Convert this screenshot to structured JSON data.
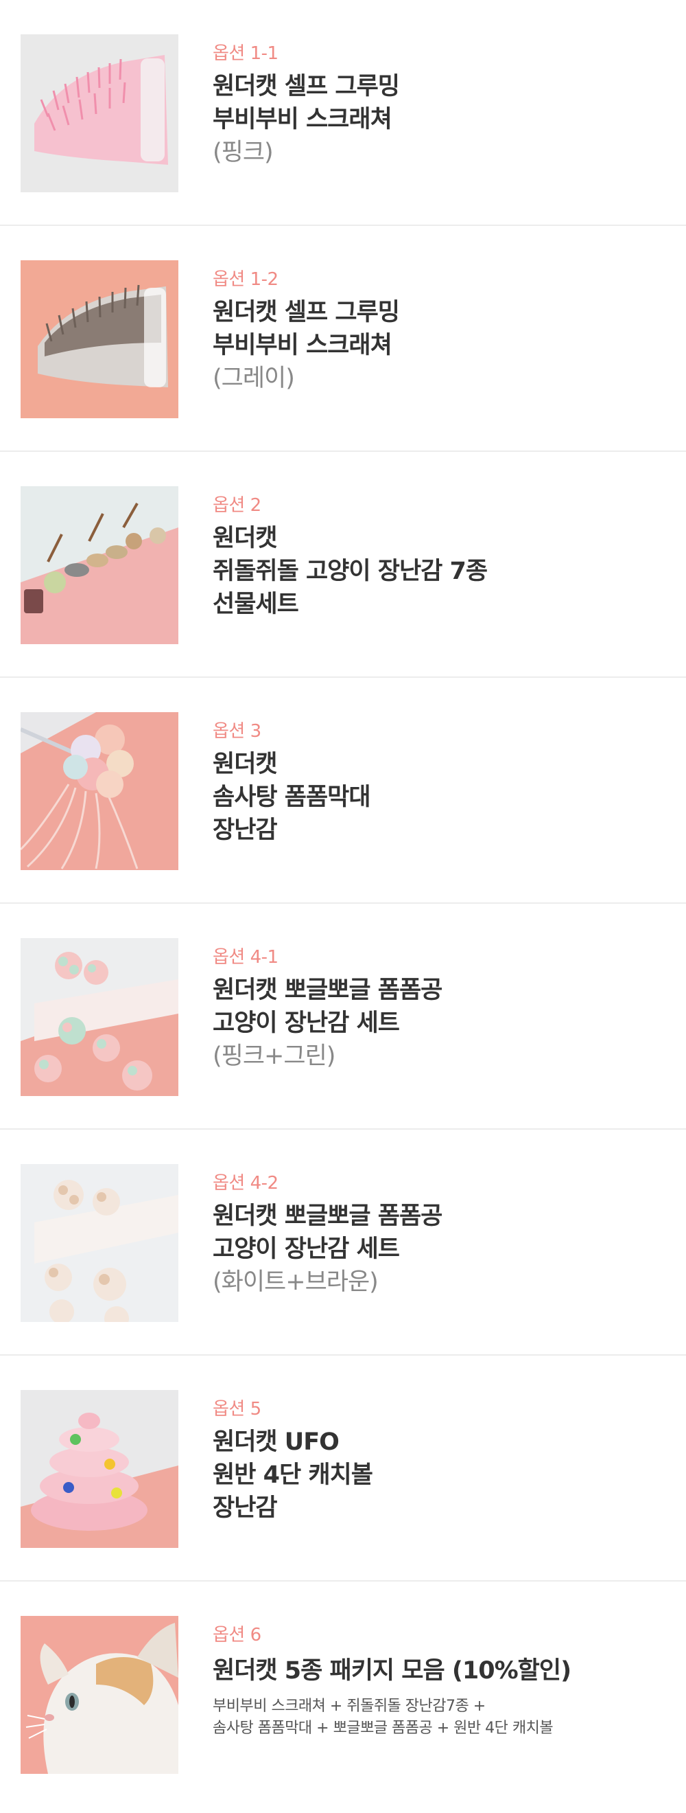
{
  "options": [
    {
      "label": "옵션 1-1",
      "lines": [
        "원더캣 셀프 그루밍",
        "부비부비 스크래쳐"
      ],
      "sub": "(핑크)"
    },
    {
      "label": "옵션 1-2",
      "lines": [
        "원더캣 셀프 그루밍",
        "부비부비 스크래쳐"
      ],
      "sub": "(그레이)"
    },
    {
      "label": "옵션 2",
      "lines": [
        "원더캣",
        "쥐돌쥐돌 고양이 장난감 7종",
        "선물세트"
      ]
    },
    {
      "label": "옵션 3",
      "lines": [
        "원더캣",
        "솜사탕 폼폼막대",
        "장난감"
      ]
    },
    {
      "label": "옵션 4-1",
      "lines": [
        "원더캣 뽀글뽀글 폼폼공",
        "고양이 장난감 세트"
      ],
      "sub": "(핑크+그린)"
    },
    {
      "label": "옵션 4-2",
      "lines": [
        "원더캣 뽀글뽀글 폼폼공",
        "고양이 장난감 세트"
      ],
      "sub": "(화이트+브라운)"
    },
    {
      "label": "옵션 5",
      "lines": [
        "원더캣 UFO",
        "원반 4단 캐치볼",
        "장난감"
      ]
    },
    {
      "label": "옵션 6",
      "lines": [
        "원더캣 5종 패키지 모음 (10%할인)"
      ],
      "desc": [
        "부비부비 스크래쳐 + 쥐돌쥐돌 장난감7종 +",
        "솜사탕 폼폼막대 + 뽀글뽀글 폼폼공 + 원반 4단 캐치볼"
      ]
    }
  ]
}
